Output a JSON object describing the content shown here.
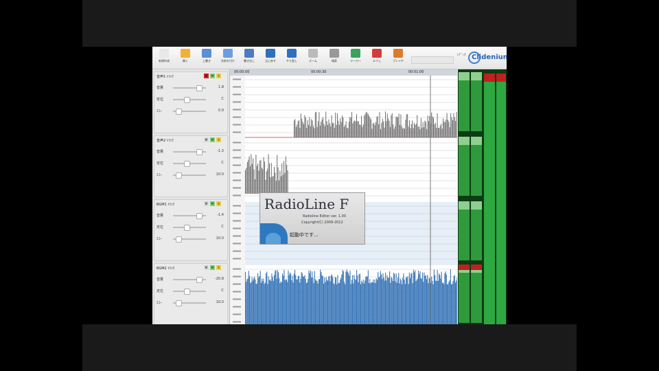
{
  "toolbar": {
    "buttons": [
      {
        "name": "new-button",
        "label": "新規作成",
        "icon": "new-file-icon",
        "color": "#e8e8e8"
      },
      {
        "name": "open-button",
        "label": "開く",
        "icon": "folder-icon",
        "color": "#f2b035"
      },
      {
        "name": "save-button",
        "label": "上書き",
        "icon": "save-icon",
        "color": "#5b8fd6"
      },
      {
        "name": "save-as-button",
        "label": "名前を付け",
        "icon": "save-as-icon",
        "color": "#6b9ee0"
      },
      {
        "name": "export-button",
        "label": "書き出し",
        "icon": "export-icon",
        "color": "#4c7cc4"
      },
      {
        "name": "undo-button",
        "label": "元に戻す",
        "icon": "undo-icon",
        "color": "#2f6fc0"
      },
      {
        "name": "redo-button",
        "label": "やり直し",
        "icon": "redo-icon",
        "color": "#2f6fc0"
      },
      {
        "name": "zoom-button",
        "label": "ズーム",
        "icon": "zoom-icon",
        "color": "#bbbbbb"
      },
      {
        "name": "search-button",
        "label": "検索",
        "icon": "magnifier-icon",
        "color": "#999999"
      },
      {
        "name": "marker-button",
        "label": "マーカー",
        "icon": "marker-icon",
        "color": "#3aa35a"
      },
      {
        "name": "effect-button",
        "label": "エフェ",
        "icon": "effect-icon",
        "color": "#d43c3c"
      },
      {
        "name": "play-button",
        "label": "プレイヤ",
        "icon": "player-icon",
        "color": "#e07a2a"
      }
    ],
    "logo_small": "ﾚﾃﾞｨｵ",
    "logo_text": "Clideniun"
  },
  "tracks": [
    {
      "name": "音声1 ﾄﾗｯｸ",
      "volume_label": "音量",
      "volume_value": "1.8",
      "pan_label": "定位",
      "pan_value": "C",
      "eq_label": "ｴｺｰ",
      "eq_value": "0.0",
      "mute_color": "#d42020"
    },
    {
      "name": "音声2 ﾄﾗｯｸ",
      "volume_label": "音量",
      "volume_value": "-1.3",
      "pan_label": "定位",
      "pan_value": "C",
      "eq_label": "ｴｺｰ",
      "eq_value": "10.0",
      "mute_color": "#d8d8d8"
    },
    {
      "name": "BGM1 ﾄﾗｯｸ",
      "volume_label": "音量",
      "volume_value": "-1.4",
      "pan_label": "定位",
      "pan_value": "C",
      "eq_label": "ｴｺｰ",
      "eq_value": "10.0",
      "mute_color": "#d8d8d8"
    },
    {
      "name": "BGM2 ﾄﾗｯｸ",
      "volume_label": "音量",
      "volume_value": "-20.8",
      "pan_label": "定位",
      "pan_value": "C",
      "eq_label": "ｴｺｰ",
      "eq_value": "10.0",
      "mute_color": "#d8d8d8"
    }
  ],
  "ruler": {
    "labels": [
      "00:00:00",
      "00:00:30",
      "00:01:00"
    ]
  },
  "splash": {
    "title": "RadioLine F",
    "subtitle": "Radioline Editor ver. 1.00",
    "copyright": "Copyright(C) 2009-2012",
    "loading": "起動中です..."
  },
  "colors": {
    "wave_gray": "#6e6e6e",
    "wave_blue": "#3c78b8",
    "meter_green": "#2ea840",
    "meter_red": "#c02020"
  }
}
